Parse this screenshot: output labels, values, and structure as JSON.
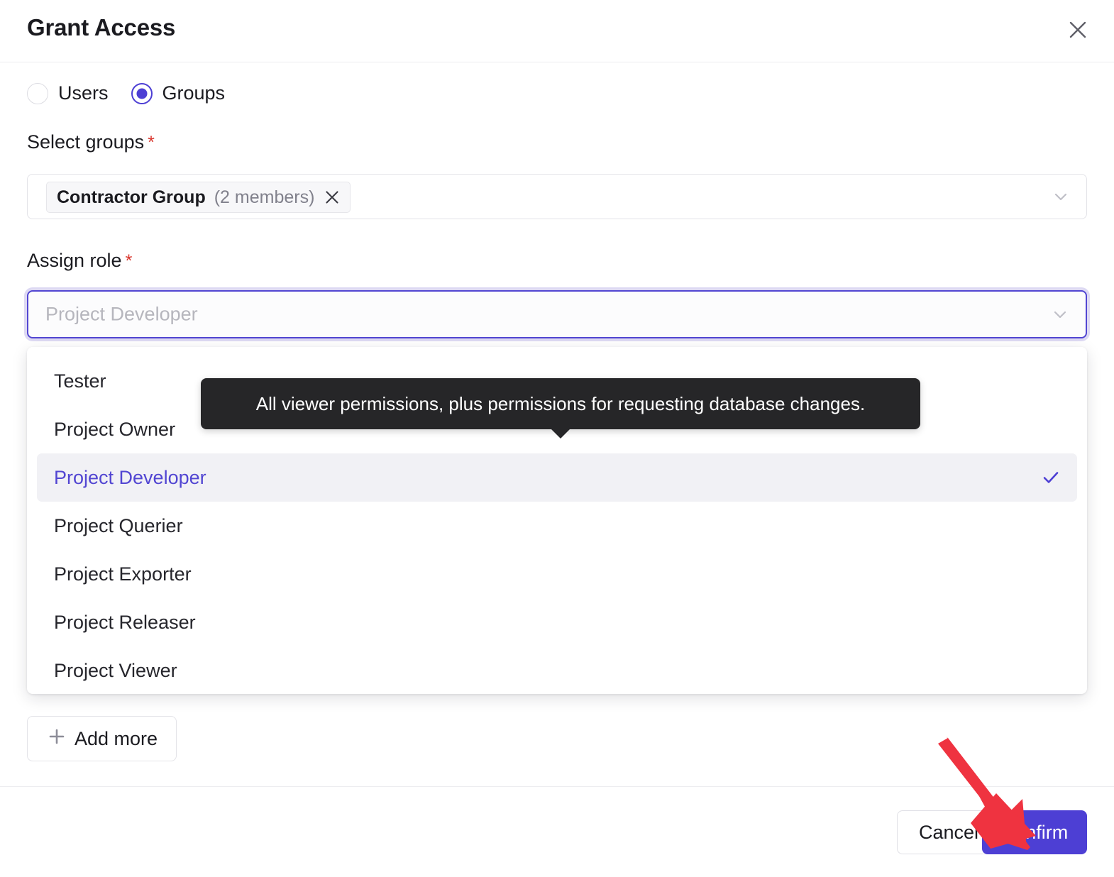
{
  "header": {
    "title": "Grant Access",
    "close_icon": "close-icon"
  },
  "scope": {
    "options": [
      {
        "label": "Users",
        "selected": false
      },
      {
        "label": "Groups",
        "selected": true
      }
    ]
  },
  "groups_field": {
    "label": "Select groups",
    "required_marker": "*",
    "chip": {
      "name": "Contractor Group",
      "count": "(2 members)",
      "remove_icon": "close-icon"
    },
    "chevron_icon": "chevron-down-icon"
  },
  "role_field": {
    "label": "Assign role",
    "required_marker": "*",
    "placeholder": "Project Developer",
    "chevron_icon": "chevron-down-icon",
    "options": [
      {
        "label": "Tester",
        "selected": false
      },
      {
        "label": "Project Owner",
        "selected": false
      },
      {
        "label": "Project Developer",
        "selected": true
      },
      {
        "label": "Project Querier",
        "selected": false
      },
      {
        "label": "Project Exporter",
        "selected": false
      },
      {
        "label": "Project Releaser",
        "selected": false
      },
      {
        "label": "Project Viewer",
        "selected": false
      }
    ]
  },
  "tooltip": {
    "text": "All viewer permissions, plus permissions for requesting database changes."
  },
  "add_more": {
    "label": "Add more",
    "icon": "plus-icon"
  },
  "footer": {
    "cancel_label": "Cancel",
    "confirm_label": "Confirm"
  },
  "colors": {
    "accent": "#4d3fd4",
    "accent_border": "#5246d2",
    "focus_ring": "#ddd9f3",
    "required": "#d9352c",
    "tooltip_bg": "#262628",
    "annotation_arrow": "#ef3340",
    "selected_row_bg": "#f1f1f5"
  }
}
